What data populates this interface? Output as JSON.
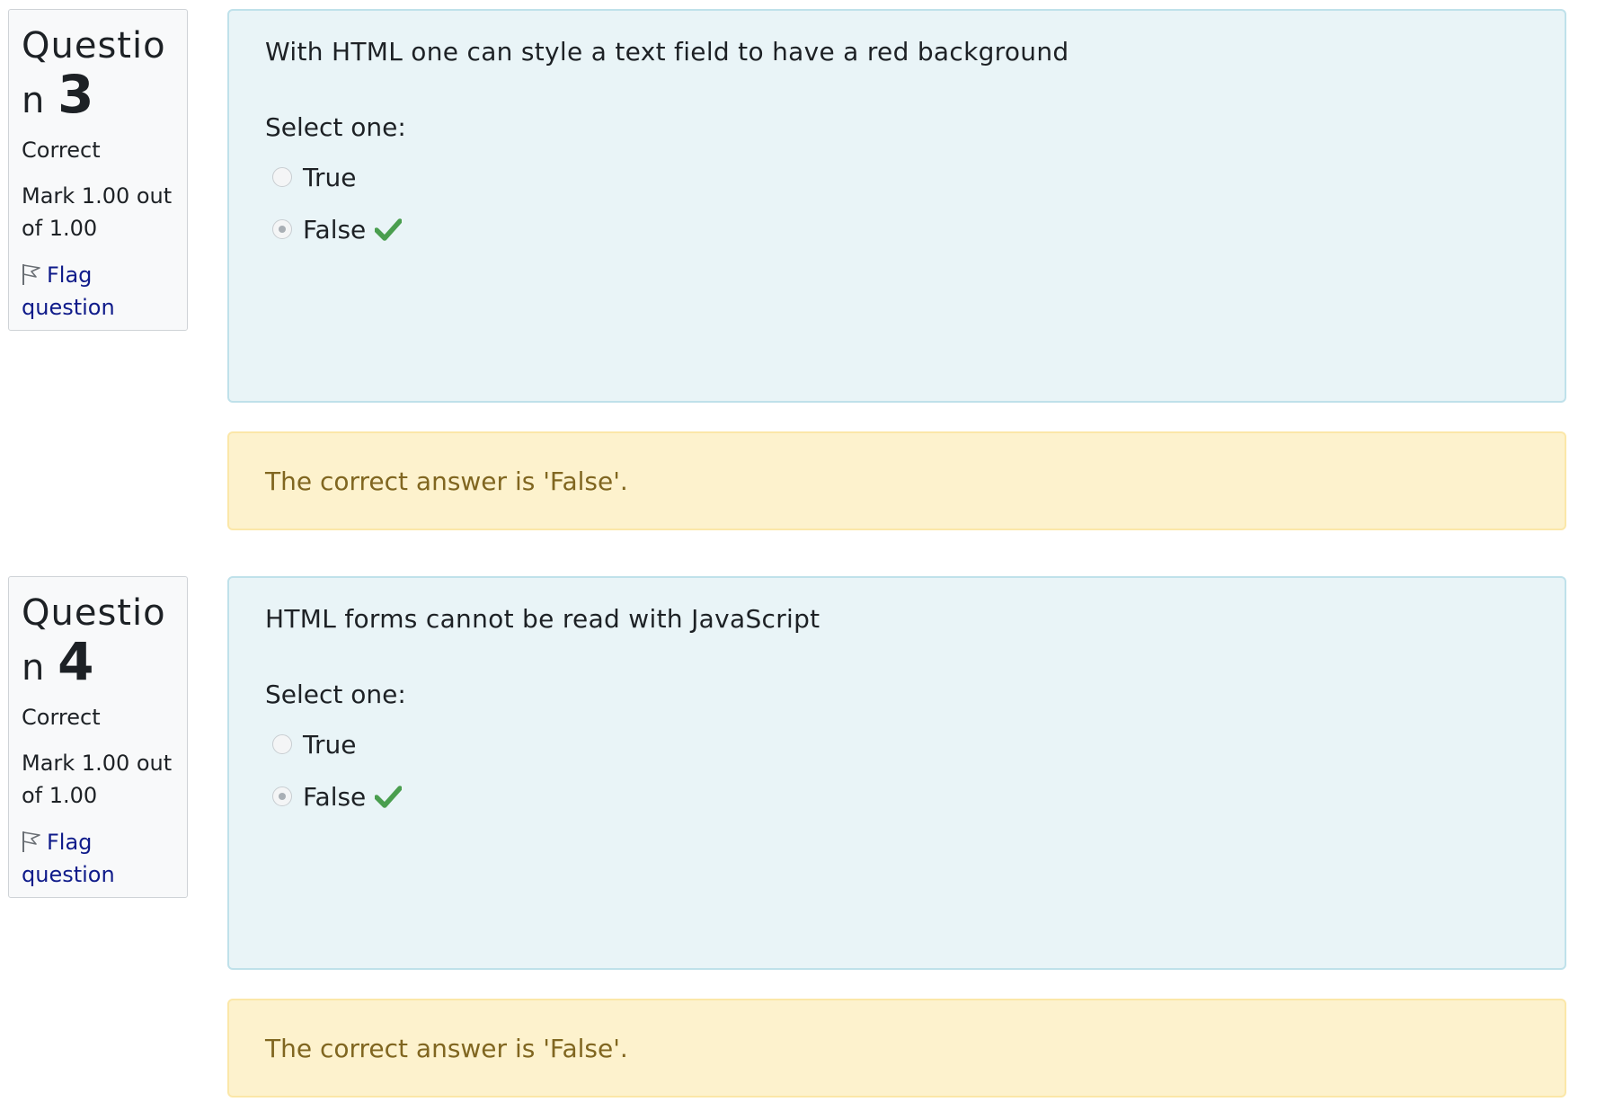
{
  "questions": [
    {
      "number_prefix": "Questio",
      "number_suffix": "n",
      "number": "3",
      "state": "Correct",
      "grade": "Mark 1.00 out of 1.00",
      "flag_label_1": "Flag",
      "flag_label_2": "question",
      "text": "With HTML one can style a text field to have a red background",
      "prompt": "Select one:",
      "options": [
        {
          "label": "True",
          "checked": false
        },
        {
          "label": "False",
          "checked": true
        }
      ],
      "feedback": "The correct answer is 'False'."
    },
    {
      "number_prefix": "Questio",
      "number_suffix": "n",
      "number": "4",
      "state": "Correct",
      "grade": "Mark 1.00 out of 1.00",
      "flag_label_1": "Flag",
      "flag_label_2": "question",
      "text": "HTML forms cannot be read with JavaScript",
      "prompt": "Select one:",
      "options": [
        {
          "label": "True",
          "checked": false
        },
        {
          "label": "False",
          "checked": true
        }
      ],
      "feedback": "The correct answer is 'False'."
    }
  ],
  "colors": {
    "formulation_bg": "#e9f4f7",
    "feedback_bg": "#fdf2cd",
    "feedback_text": "#806620",
    "correct_check": "#4a9e4f",
    "link": "#0f1b8a"
  },
  "icons": {
    "flag": "flag-icon",
    "correct": "check-icon"
  }
}
